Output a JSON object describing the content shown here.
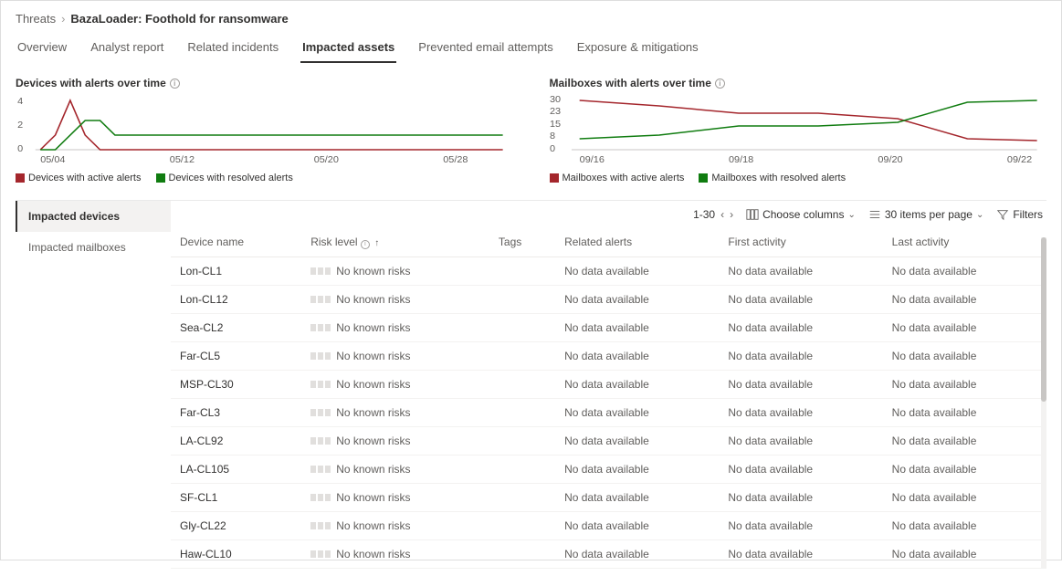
{
  "breadcrumb": {
    "parent": "Threats",
    "current": "BazaLoader: Foothold for ransomware"
  },
  "tabs": [
    {
      "label": "Overview"
    },
    {
      "label": "Analyst report"
    },
    {
      "label": "Related incidents"
    },
    {
      "label": "Impacted assets",
      "active": true
    },
    {
      "label": "Prevented email attempts"
    },
    {
      "label": "Exposure & mitigations"
    }
  ],
  "charts": {
    "devices": {
      "title": "Devices with alerts over time",
      "legend_active": "Devices with active alerts",
      "legend_resolved": "Devices with resolved alerts"
    },
    "mailboxes": {
      "title": "Mailboxes with alerts over time",
      "legend_active": "Mailboxes with active alerts",
      "legend_resolved": "Mailboxes with resolved alerts"
    }
  },
  "chart_data": [
    {
      "type": "line",
      "title": "Devices with alerts over time",
      "x_ticks": [
        "05/04",
        "05/12",
        "05/20",
        "05/28"
      ],
      "y_ticks": [
        0,
        2,
        4
      ],
      "ylim": [
        0,
        4
      ],
      "series": [
        {
          "name": "Devices with active alerts",
          "color": "#a4262c",
          "x": [
            0,
            1,
            2,
            3,
            4,
            5,
            6,
            7,
            8,
            9,
            10,
            11,
            12,
            13,
            14,
            15,
            16,
            17,
            18,
            19,
            20,
            21,
            22,
            23,
            24,
            25,
            26,
            27,
            28,
            29
          ],
          "values": [
            0,
            1,
            4,
            1,
            0,
            0,
            0,
            0,
            0,
            0,
            0,
            0,
            0,
            0,
            0,
            0,
            0,
            0,
            0,
            0,
            0,
            0,
            0,
            0,
            0,
            0,
            0,
            0,
            0,
            0
          ]
        },
        {
          "name": "Devices with resolved alerts",
          "color": "#107c10",
          "x": [
            0,
            1,
            2,
            3,
            4,
            5,
            6,
            7,
            8,
            9,
            10,
            11,
            12,
            13,
            14,
            15,
            16,
            17,
            18,
            19,
            20,
            21,
            22,
            23,
            24,
            25,
            26,
            27,
            28,
            29
          ],
          "values": [
            0,
            0,
            1,
            2,
            2,
            1,
            1,
            1,
            1,
            1,
            1,
            1,
            1,
            1,
            1,
            1,
            1,
            1,
            1,
            1,
            1,
            1,
            1,
            1,
            1,
            1,
            1,
            1,
            1,
            1
          ]
        }
      ]
    },
    {
      "type": "line",
      "title": "Mailboxes with alerts over time",
      "x_ticks": [
        "09/16",
        "09/18",
        "09/20",
        "09/22"
      ],
      "y_ticks": [
        0,
        8,
        15,
        23,
        30
      ],
      "ylim": [
        0,
        30
      ],
      "series": [
        {
          "name": "Mailboxes with active alerts",
          "color": "#a4262c",
          "x": [
            0,
            1,
            2,
            3,
            4,
            5,
            6
          ],
          "values": [
            30,
            27,
            23,
            23,
            20,
            10,
            9
          ]
        },
        {
          "name": "Mailboxes with resolved alerts",
          "color": "#107c10",
          "x": [
            0,
            1,
            2,
            3,
            4,
            5,
            6
          ],
          "values": [
            8,
            10,
            15,
            15,
            17,
            28,
            30
          ]
        }
      ]
    }
  ],
  "side_tabs": [
    {
      "label": "Impacted devices",
      "active": true
    },
    {
      "label": "Impacted mailboxes"
    }
  ],
  "toolbar": {
    "range": "1-30",
    "choose_columns": "Choose columns",
    "items_per_page": "30 items per page",
    "filters": "Filters"
  },
  "table": {
    "columns": {
      "device_name": "Device name",
      "risk_level": "Risk level",
      "tags": "Tags",
      "related_alerts": "Related alerts",
      "first_activity": "First activity",
      "last_activity": "Last activity"
    },
    "no_known_risks": "No known risks",
    "no_data": "No data available",
    "rows": [
      {
        "name": "Lon-CL1"
      },
      {
        "name": "Lon-CL12"
      },
      {
        "name": "Sea-CL2"
      },
      {
        "name": "Far-CL5"
      },
      {
        "name": "MSP-CL30"
      },
      {
        "name": "Far-CL3"
      },
      {
        "name": "LA-CL92"
      },
      {
        "name": "LA-CL105"
      },
      {
        "name": "SF-CL1"
      },
      {
        "name": "Gly-CL22"
      },
      {
        "name": "Haw-CL10"
      }
    ]
  }
}
